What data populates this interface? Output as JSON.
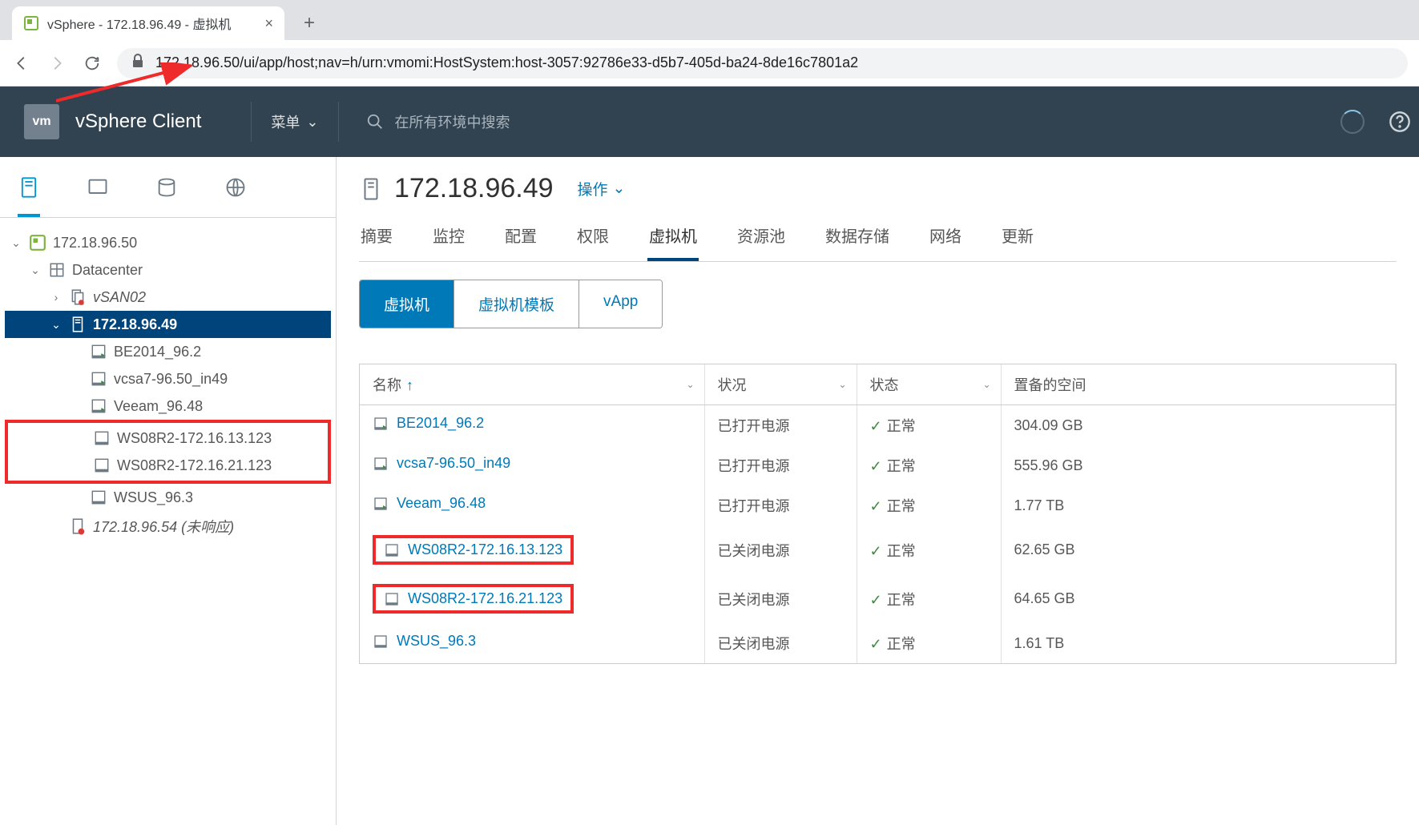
{
  "browser": {
    "tab_title": "vSphere - 172.18.96.49 - 虚拟机",
    "url": "172.18.96.50/ui/app/host;nav=h/urn:vmomi:HostSystem:host-3057:92786e33-d5b7-405d-ba24-8de16c7801a2"
  },
  "header": {
    "logo_text": "vm",
    "product": "vSphere Client",
    "menu_label": "菜单",
    "search_placeholder": "在所有环境中搜索"
  },
  "tree": {
    "root": "172.18.96.50",
    "datacenter": "Datacenter",
    "cluster": "vSAN02",
    "host_selected": "172.18.96.49",
    "vms": [
      "BE2014_96.2",
      "vcsa7-96.50_in49",
      "Veeam_96.48",
      "WS08R2-172.16.13.123",
      "WS08R2-172.16.21.123",
      "WSUS_96.3"
    ],
    "host_error": "172.18.96.54 (未响应)"
  },
  "main": {
    "title": "172.18.96.49",
    "actions_label": "操作",
    "tabs": [
      "摘要",
      "监控",
      "配置",
      "权限",
      "虚拟机",
      "资源池",
      "数据存储",
      "网络",
      "更新"
    ],
    "active_tab": "虚拟机",
    "sub_tabs": [
      "虚拟机",
      "虚拟机模板",
      "vApp"
    ],
    "table": {
      "headers": {
        "name": "名称",
        "status": "状况",
        "state": "状态",
        "space": "置备的空间"
      },
      "rows": [
        {
          "name": "BE2014_96.2",
          "running": true,
          "status": "已打开电源",
          "state": "正常",
          "space": "304.09 GB"
        },
        {
          "name": "vcsa7-96.50_in49",
          "running": true,
          "status": "已打开电源",
          "state": "正常",
          "space": "555.96 GB"
        },
        {
          "name": "Veeam_96.48",
          "running": true,
          "status": "已打开电源",
          "state": "正常",
          "space": "1.77 TB"
        },
        {
          "name": "WS08R2-172.16.13.123",
          "running": false,
          "status": "已关闭电源",
          "state": "正常",
          "space": "62.65 GB",
          "highlight": true
        },
        {
          "name": "WS08R2-172.16.21.123",
          "running": false,
          "status": "已关闭电源",
          "state": "正常",
          "space": "64.65 GB",
          "highlight": true
        },
        {
          "name": "WSUS_96.3",
          "running": false,
          "status": "已关闭电源",
          "state": "正常",
          "space": "1.61 TB"
        }
      ]
    }
  }
}
